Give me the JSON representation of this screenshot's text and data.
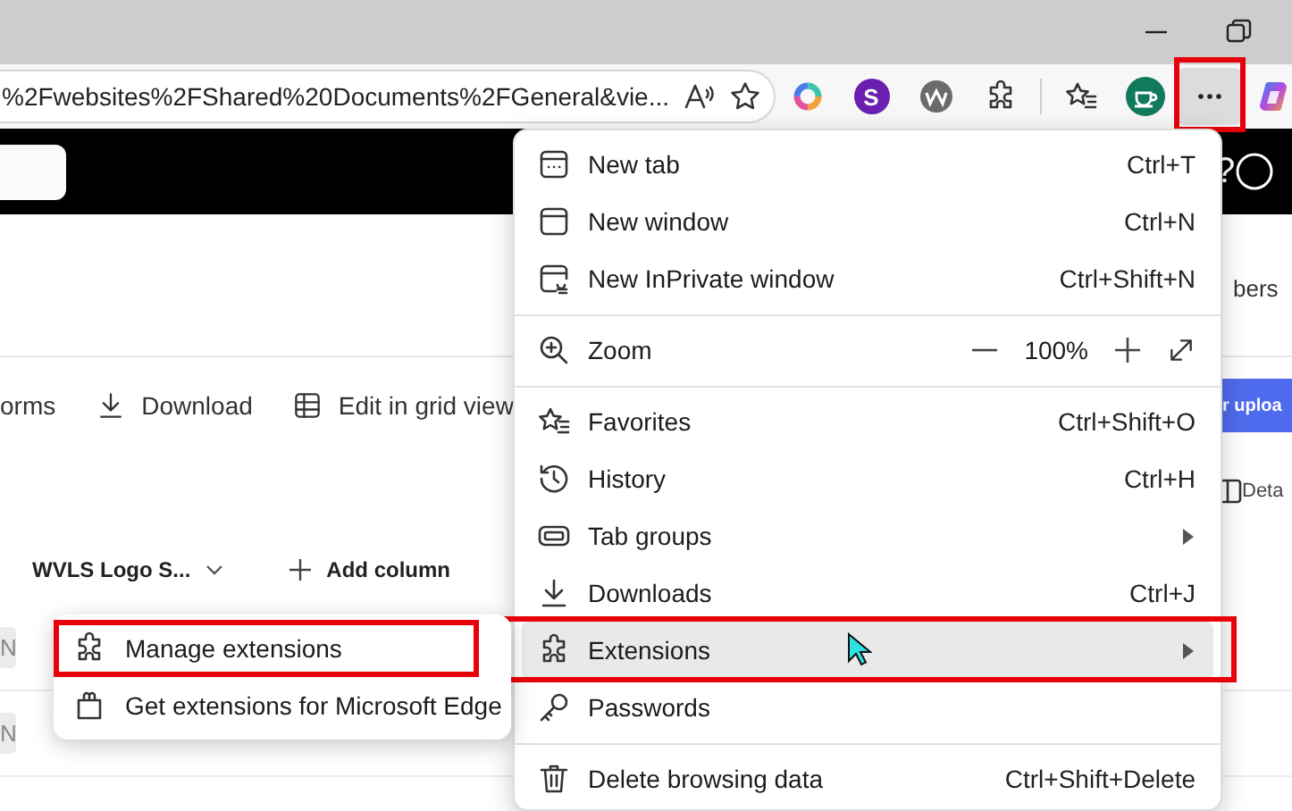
{
  "address_bar": {
    "url": "%2Fwebsites%2FShared%20Documents%2FGeneral&vie..."
  },
  "toolbar": {
    "extension_letter": "S",
    "menu_button": {
      "pressed": true,
      "highlighted": true
    }
  },
  "page": {
    "help_glyph": "?",
    "members_text": "bers",
    "commands": [
      "orms",
      "Download",
      "Edit in grid view"
    ],
    "upload_button": "r uploa",
    "details_label": "Deta",
    "columns": [
      {
        "kind": "dropdown",
        "label": "WVLS Logo S..."
      },
      {
        "kind": "add",
        "label": "Add column"
      }
    ],
    "rows": [
      {
        "cell": "N"
      },
      {
        "cell": "N"
      }
    ]
  },
  "menu": {
    "items": [
      {
        "kind": "item",
        "label": "New tab",
        "shortcut": "Ctrl+T",
        "hovered": false,
        "highlighted": false
      },
      {
        "kind": "item",
        "label": "New window",
        "shortcut": "Ctrl+N",
        "hovered": false,
        "highlighted": false
      },
      {
        "kind": "item",
        "label": "New InPrivate window",
        "shortcut": "Ctrl+Shift+N",
        "hovered": false,
        "highlighted": false
      },
      {
        "kind": "divider"
      },
      {
        "kind": "zoom",
        "label": "Zoom",
        "value": "100%",
        "hovered": false,
        "highlighted": false
      },
      {
        "kind": "divider"
      },
      {
        "kind": "item",
        "label": "Favorites",
        "shortcut": "Ctrl+Shift+O",
        "hovered": false,
        "highlighted": false
      },
      {
        "kind": "item",
        "label": "History",
        "shortcut": "Ctrl+H",
        "hovered": false,
        "highlighted": false
      },
      {
        "kind": "submenu",
        "label": "Tab groups",
        "hovered": false,
        "highlighted": false
      },
      {
        "kind": "item",
        "label": "Downloads",
        "shortcut": "Ctrl+J",
        "hovered": false,
        "highlighted": false
      },
      {
        "kind": "submenu",
        "label": "Extensions",
        "hovered": true,
        "highlighted": true
      },
      {
        "kind": "item",
        "label": "Passwords",
        "hovered": false,
        "highlighted": false
      },
      {
        "kind": "divider"
      },
      {
        "kind": "item",
        "label": "Delete browsing data",
        "shortcut": "Ctrl+Shift+Delete",
        "hovered": false,
        "highlighted": false
      }
    ]
  },
  "submenu": {
    "items": [
      {
        "label": "Manage extensions",
        "highlighted": true
      },
      {
        "label": "Get extensions for Microsoft Edge",
        "highlighted": false
      }
    ]
  }
}
